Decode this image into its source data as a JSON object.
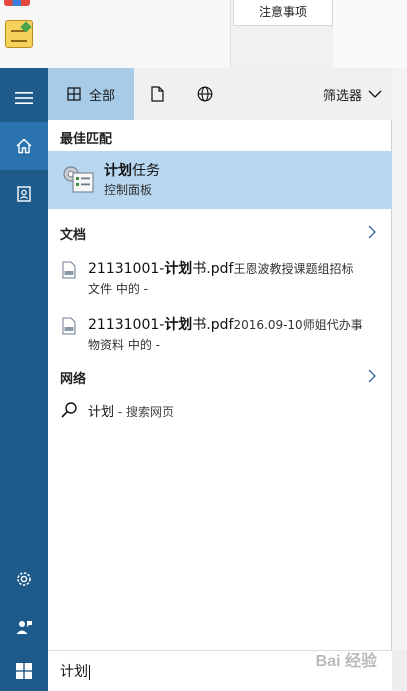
{
  "desktop": {
    "note_tab": "注意事项"
  },
  "tabs": {
    "all_label": "全部",
    "filter_label": "筛选器"
  },
  "best_match": {
    "section": "最佳匹配",
    "title_bold": "计划",
    "title_rest": "任务",
    "subtitle": "控制面板"
  },
  "documents": {
    "section": "文档",
    "items": [
      {
        "name_prefix": "21131001-",
        "name_bold": "计划",
        "name_suffix": "书.pdf",
        "location_a": "王恩波教授课题组招标",
        "location_b": "文件 中的 -"
      },
      {
        "name_prefix": "21131001-",
        "name_bold": "计划",
        "name_suffix": "书.pdf",
        "location_a": "2016.09-10师姐代办事",
        "location_b": "物资料 中的 -"
      }
    ]
  },
  "web": {
    "section": "网络",
    "query": "计划",
    "hint": " - 搜索网页"
  },
  "searchbar": {
    "text": "计划"
  },
  "watermark": "Bai 经验",
  "icons": [
    "hamburger-icon",
    "home-icon",
    "notebook-icon",
    "settings-icon",
    "feedback-icon",
    "windows-icon",
    "grid-icon",
    "document-icon",
    "globe-icon",
    "chevron-down-icon",
    "chevron-right-icon",
    "pdf-icon",
    "search-icon",
    "control-panel-icon"
  ]
}
